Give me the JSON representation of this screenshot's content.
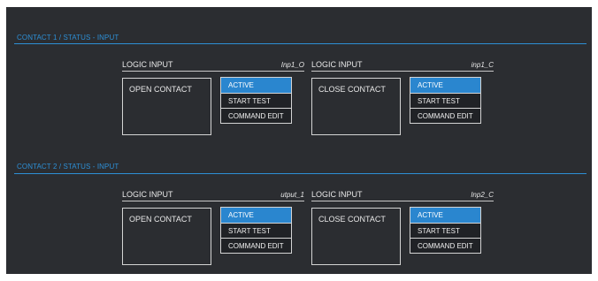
{
  "sections": [
    {
      "title": "CONTACT 1 / STATUS - INPUT",
      "groups": [
        {
          "logic_label": "LOGIC INPUT",
          "code": "Inp1_O",
          "contact_label": "OPEN CONTACT",
          "commands": [
            "ACTIVE",
            "START TEST",
            "COMMAND EDIT"
          ]
        },
        {
          "logic_label": "LOGIC INPUT",
          "code": "inp1_C",
          "contact_label": "CLOSE CONTACT",
          "commands": [
            "ACTIVE",
            "START TEST",
            "COMMAND EDIT"
          ]
        }
      ]
    },
    {
      "title": "CONTACT 2 / STATUS - INPUT",
      "groups": [
        {
          "logic_label": "LOGIC INPUT",
          "code": "utput_1",
          "contact_label": "OPEN CONTACT",
          "commands": [
            "ACTIVE",
            "START TEST",
            "COMMAND EDIT"
          ]
        },
        {
          "logic_label": "LOGIC INPUT",
          "code": "Inp2_C",
          "contact_label": "CLOSE CONTACT",
          "commands": [
            "ACTIVE",
            "START TEST",
            "COMMAND EDIT"
          ]
        }
      ]
    }
  ],
  "colors": {
    "panel_bg": "#2b2d31",
    "accent": "#2d8fd5",
    "active_bg": "#2a86cf"
  }
}
